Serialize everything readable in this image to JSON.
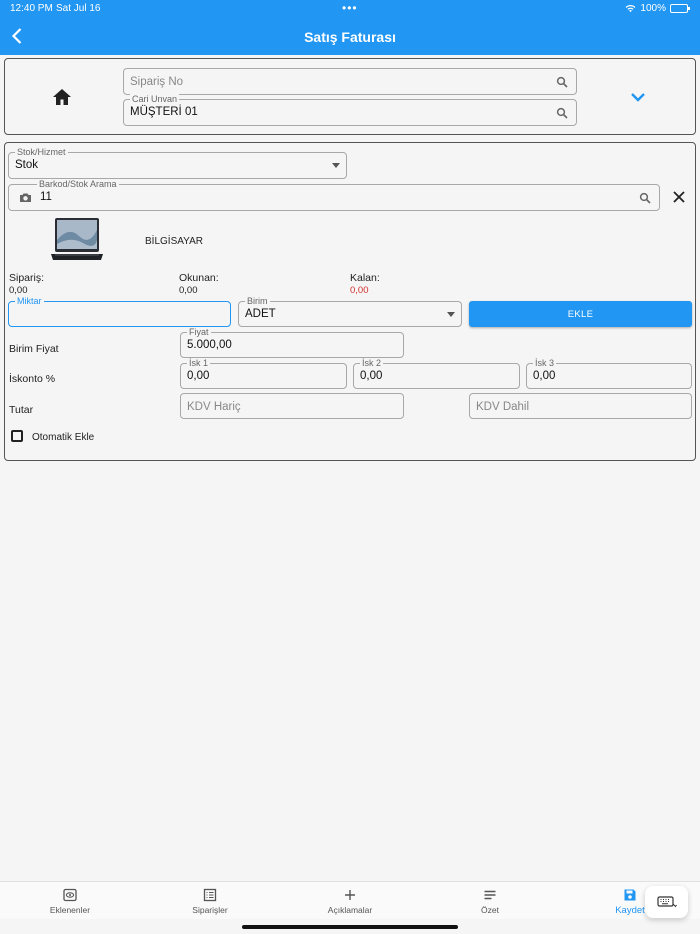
{
  "status_bar": {
    "time": "12:40 PM",
    "date": "Sat Jul 16",
    "dots": "•••",
    "battery": "100%"
  },
  "header": {
    "title": "Satış Faturası",
    "back_icon": "chevron-left-icon"
  },
  "top_panel": {
    "home_icon": "home-icon",
    "siparis_no": {
      "placeholder": "Sipariş No",
      "value": ""
    },
    "cari_unvan": {
      "label": "Cari Unvan",
      "value": "MÜŞTERİ 01"
    },
    "expand_icon": "chevron-down-icon"
  },
  "form": {
    "stok_hizmet": {
      "label": "Stok/Hizmet",
      "value": "Stok"
    },
    "barkod": {
      "label": "Barkod/Stok Arama",
      "value": "11"
    },
    "product_name": "BİLGİSAYAR",
    "siparis": {
      "label": "Sipariş:",
      "value": "0,00"
    },
    "okunan": {
      "label": "Okunan:",
      "value": "0,00"
    },
    "kalan": {
      "label": "Kalan:",
      "value": "0,00"
    },
    "miktar": {
      "label": "Miktar",
      "value": ""
    },
    "birim": {
      "label": "Birim",
      "value": "ADET"
    },
    "ekle_button": "EKLE",
    "birim_fiyat_label": "Birim Fiyat",
    "fiyat": {
      "label": "Fiyat",
      "value": "5.000,00"
    },
    "iskonto_label": "İskonto %",
    "isk1": {
      "label": "İsk 1",
      "value": "0,00"
    },
    "isk2": {
      "label": "İsk 2",
      "value": "0,00"
    },
    "isk3": {
      "label": "İsk 3",
      "value": "0,00"
    },
    "tutar_label": "Tutar",
    "kdv_haric": {
      "placeholder": "KDV Hariç"
    },
    "kdv_dahil": {
      "placeholder": "KDV Dahil"
    },
    "otomatik_ekle": {
      "label": "Otomatik Ekle",
      "checked": false
    }
  },
  "bottom_nav": {
    "tabs": [
      {
        "label": "Eklenenler",
        "icon": "eye-doc-icon"
      },
      {
        "label": "Siparişler",
        "icon": "list-icon"
      },
      {
        "label": "Açıklamalar",
        "icon": "plus-icon"
      },
      {
        "label": "Özet",
        "icon": "lines-icon"
      },
      {
        "label": "Kaydet",
        "icon": "save-icon",
        "active": true
      }
    ]
  },
  "colors": {
    "primary": "#2196f3",
    "danger": "#d32f2f"
  }
}
